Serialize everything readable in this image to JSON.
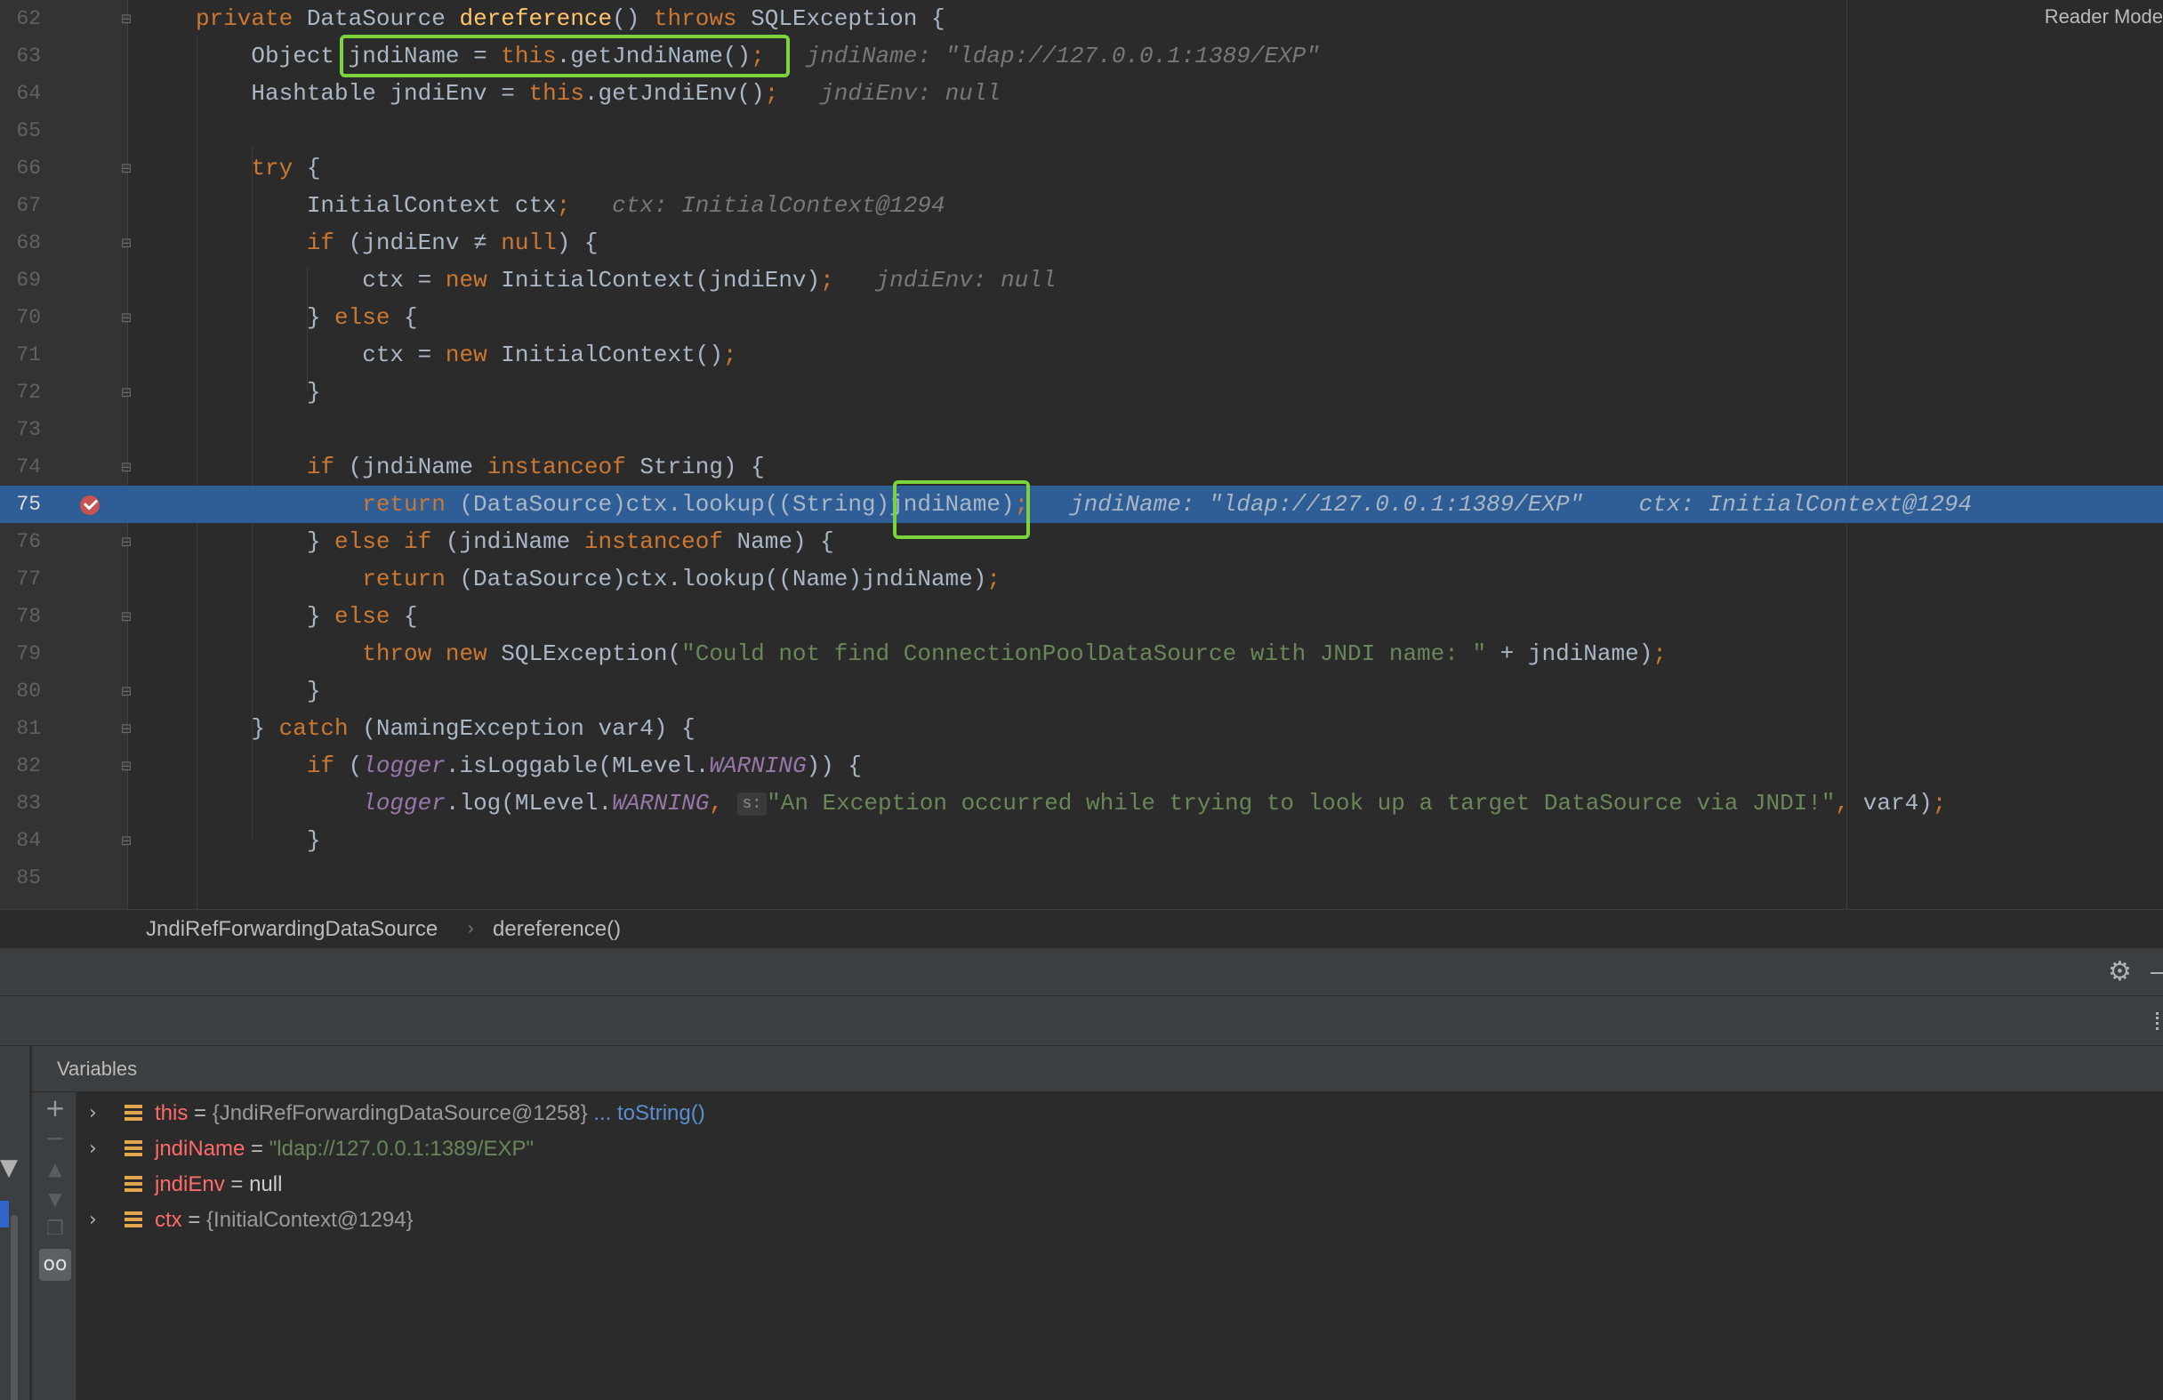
{
  "editor": {
    "reader_mode": "Reader Mode",
    "lines": [
      {
        "n": "62",
        "tokens": [
          [
            "kw",
            "private "
          ],
          [
            "",
            "DataSource "
          ],
          [
            "mth",
            "dereference"
          ],
          [
            "",
            "() "
          ],
          [
            "kw",
            "throws "
          ],
          [
            "",
            "SQLException {"
          ]
        ]
      },
      {
        "n": "63",
        "tokens": [
          [
            "",
            "    Object "
          ],
          [
            "",
            "jndiName = "
          ],
          [
            "kw",
            "this"
          ],
          [
            "",
            ".getJndiName()"
          ],
          [
            "kw",
            ";"
          ],
          [
            "hint",
            "   jndiName: \"ldap://127.0.0.1:1389/EXP\""
          ]
        ]
      },
      {
        "n": "64",
        "tokens": [
          [
            "",
            "    Hashtable jndiEnv = "
          ],
          [
            "kw",
            "this"
          ],
          [
            "",
            ".getJndiEnv()"
          ],
          [
            "kw",
            ";"
          ],
          [
            "hint",
            "   jndiEnv: null"
          ]
        ]
      },
      {
        "n": "65",
        "tokens": []
      },
      {
        "n": "66",
        "tokens": [
          [
            "kw",
            "    try "
          ],
          [
            "",
            "{"
          ]
        ]
      },
      {
        "n": "67",
        "tokens": [
          [
            "",
            "        InitialContext ctx"
          ],
          [
            "kw",
            ";"
          ],
          [
            "hint",
            "   ctx: InitialContext@1294"
          ]
        ]
      },
      {
        "n": "68",
        "tokens": [
          [
            "kw",
            "        if "
          ],
          [
            "",
            "(jndiEnv ≠ "
          ],
          [
            "kw",
            "null"
          ],
          [
            "",
            ") {"
          ]
        ]
      },
      {
        "n": "69",
        "tokens": [
          [
            "",
            "            ctx = "
          ],
          [
            "kw",
            "new "
          ],
          [
            "",
            "InitialContext(jndiEnv)"
          ],
          [
            "kw",
            ";"
          ],
          [
            "hint",
            "   jndiEnv: null"
          ]
        ]
      },
      {
        "n": "70",
        "tokens": [
          [
            "",
            "        } "
          ],
          [
            "kw",
            "else "
          ],
          [
            "",
            "{"
          ]
        ]
      },
      {
        "n": "71",
        "tokens": [
          [
            "",
            "            ctx = "
          ],
          [
            "kw",
            "new "
          ],
          [
            "",
            "InitialContext()"
          ],
          [
            "kw",
            ";"
          ]
        ]
      },
      {
        "n": "72",
        "tokens": [
          [
            "",
            "        }"
          ]
        ]
      },
      {
        "n": "73",
        "tokens": []
      },
      {
        "n": "74",
        "tokens": [
          [
            "kw",
            "        if "
          ],
          [
            "",
            "(jndiName "
          ],
          [
            "kw",
            "instanceof "
          ],
          [
            "",
            "String) {"
          ]
        ]
      },
      {
        "n": "75",
        "tokens": [
          [
            "kw",
            "            return "
          ],
          [
            "",
            "(DataSource)ctx.lookup((String)jndiName)"
          ],
          [
            "kw",
            ";"
          ],
          [
            "hint",
            "   jndiName: \"ldap://127.0.0.1:1389/EXP\"    ctx: InitialContext@1294"
          ]
        ]
      },
      {
        "n": "76",
        "tokens": [
          [
            "",
            "        } "
          ],
          [
            "kw",
            "else if "
          ],
          [
            "",
            "(jndiName "
          ],
          [
            "kw",
            "instanceof "
          ],
          [
            "",
            "Name) {"
          ]
        ]
      },
      {
        "n": "77",
        "tokens": [
          [
            "kw",
            "            return "
          ],
          [
            "",
            "(DataSource)ctx.lookup((Name)jndiName)"
          ],
          [
            "kw",
            ";"
          ]
        ]
      },
      {
        "n": "78",
        "tokens": [
          [
            "",
            "        } "
          ],
          [
            "kw",
            "else "
          ],
          [
            "",
            "{"
          ]
        ]
      },
      {
        "n": "79",
        "tokens": [
          [
            "kw",
            "            throw new "
          ],
          [
            "",
            "SQLException("
          ],
          [
            "str",
            "\"Could not find ConnectionPoolDataSource with JNDI name: \""
          ],
          [
            "",
            " + jndiName)"
          ],
          [
            "kw",
            ";"
          ]
        ]
      },
      {
        "n": "80",
        "tokens": [
          [
            "",
            "        }"
          ]
        ]
      },
      {
        "n": "81",
        "tokens": [
          [
            "",
            "    } "
          ],
          [
            "kw",
            "catch "
          ],
          [
            "",
            "(NamingException var4) {"
          ]
        ]
      },
      {
        "n": "82",
        "tokens": [
          [
            "kw",
            "        if "
          ],
          [
            "",
            "("
          ],
          [
            "fld",
            "logger"
          ],
          [
            "",
            ".isLoggable(MLevel."
          ],
          [
            "fld",
            "WARNING"
          ],
          [
            "",
            ")) {"
          ]
        ]
      },
      {
        "n": "83",
        "tokens": [
          [
            "fld",
            "            logger"
          ],
          [
            "",
            ".log(MLevel."
          ],
          [
            "fld",
            "WARNING"
          ],
          [
            "kw",
            ", "
          ],
          [
            "param",
            "s:"
          ],
          [
            "str",
            "\"An Exception occurred while trying to look up a target DataSource via JNDI!\""
          ],
          [
            "kw",
            ", "
          ],
          [
            "",
            "var4)"
          ],
          [
            "kw",
            ";"
          ]
        ]
      },
      {
        "n": "84",
        "tokens": [
          [
            "",
            "        }"
          ]
        ]
      },
      {
        "n": "85",
        "tokens": []
      }
    ]
  },
  "breadcrumb": {
    "class_name": "JndiRefForwardingDataSource",
    "separator": "›",
    "method_name": "dereference()"
  },
  "debug": {
    "variables_title": "Variables",
    "variables": [
      {
        "name": "this",
        "eq": " = ",
        "value": "{JndiRefForwardingDataSource@1258}",
        "kind": "obj",
        "extra": " ... toString()",
        "expandable": true
      },
      {
        "name": "jndiName",
        "eq": " = ",
        "value": "\"ldap://127.0.0.1:1389/EXP\"",
        "kind": "str",
        "extra": "",
        "expandable": true
      },
      {
        "name": "jndiEnv",
        "eq": " = ",
        "value": "null",
        "kind": "null",
        "extra": "",
        "expandable": false
      },
      {
        "name": "ctx",
        "eq": " = ",
        "value": "{InitialContext@1294}",
        "kind": "obj",
        "extra": "",
        "expandable": true
      }
    ]
  },
  "icons": {
    "gear": "gear-icon",
    "fold": "fold-marker-icon",
    "breakpoint": "breakpoint-icon",
    "chevron": "chevron-right-icon",
    "variable": "variable-icon"
  },
  "colors": {
    "execution_line": "#2f5d96",
    "callout": "#7bd33d",
    "keyword": "#cc7832"
  }
}
